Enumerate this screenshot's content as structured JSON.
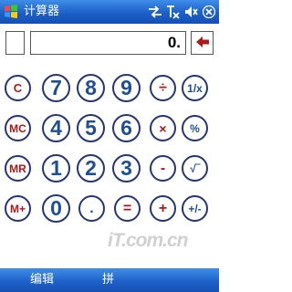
{
  "titlebar": {
    "app_title": "计算器",
    "icons": [
      "start-flag-icon",
      "sync-arrows-icon",
      "signal-off-icon",
      "volume-icon",
      "close-x-icon"
    ]
  },
  "display": {
    "memory_indicator": "",
    "value": "0.",
    "backspace_icon": "left-arrow-icon"
  },
  "keypad": {
    "row1": [
      "C",
      "7",
      "8",
      "9",
      "÷",
      "1/x"
    ],
    "row2": [
      "MC",
      "4",
      "5",
      "6",
      "×",
      "%"
    ],
    "row3": [
      "MR",
      "1",
      "2",
      "3",
      "-",
      "√‾"
    ],
    "row4": [
      "M+",
      "0",
      ".",
      "=",
      "+",
      "+/-"
    ]
  },
  "watermark": "iT.com.cn",
  "menubar": {
    "left_label": "编辑",
    "ime_label": "拼"
  },
  "colors": {
    "titlebar": "#1c5fc8",
    "key_border": "#26357a",
    "memory_keys": "#b01818",
    "digit_keys": "#1e4f95",
    "operator_keys": "#b01818"
  }
}
